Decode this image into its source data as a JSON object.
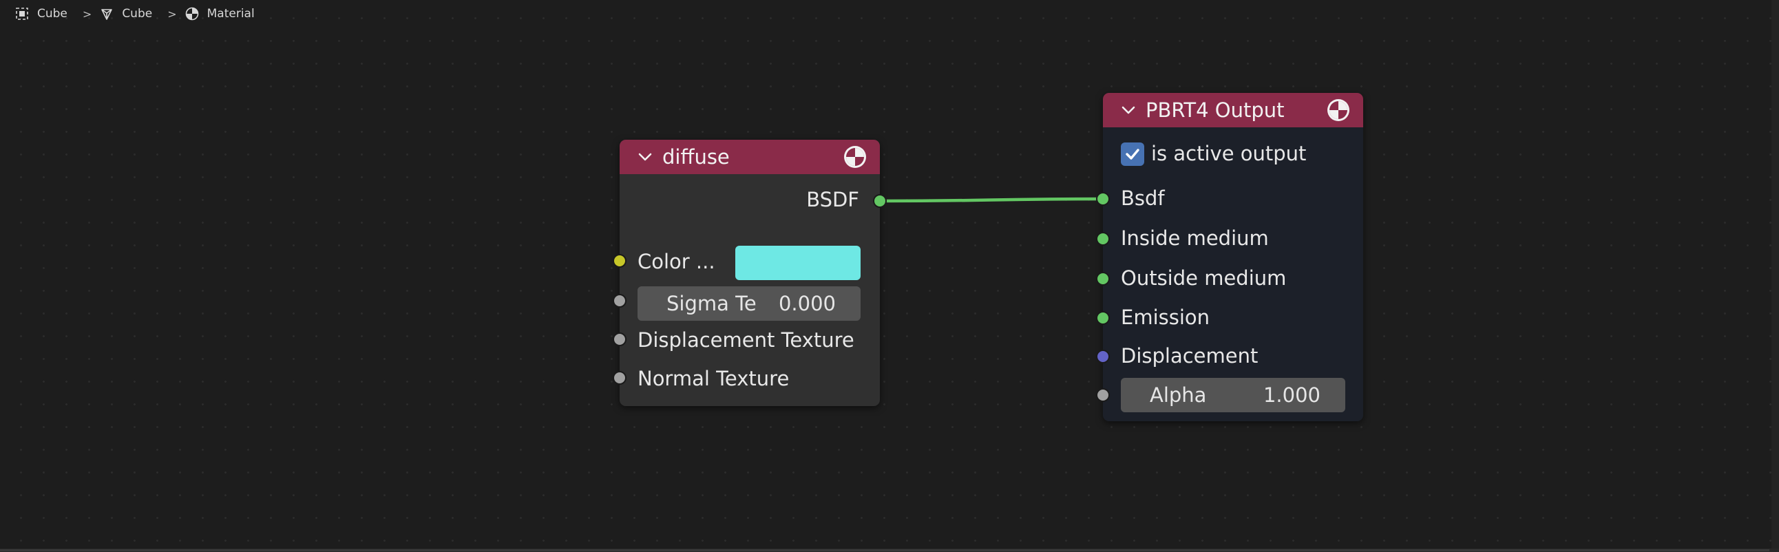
{
  "breadcrumb": {
    "items": [
      {
        "label": "Cube",
        "icon": "object-icon"
      },
      {
        "label": "Cube",
        "icon": "mesh-data-icon"
      },
      {
        "label": "Material",
        "icon": "material-sphere-icon"
      }
    ],
    "separator": ">"
  },
  "nodes": {
    "diffuse": {
      "title": "diffuse",
      "header_color": "#8a2b49",
      "output_socket": "BSDF",
      "color_label": "Color ...",
      "color_value": "#6ee8e4",
      "sigma_label": "Sigma Te",
      "sigma_value": "0.000",
      "displacement_label": "Displacement Texture",
      "normal_label": "Normal Texture"
    },
    "output": {
      "title": "PBRT4 Output",
      "header_color": "#8a2b49",
      "active_label": "is active output",
      "active_checked": true,
      "inputs": [
        "Bsdf",
        "Inside medium",
        "Outside medium",
        "Emission",
        "Displacement"
      ],
      "alpha_label": "Alpha",
      "alpha_value": "1.000"
    }
  },
  "colors": {
    "socket_shader": "#63c763",
    "socket_color": "#c7c729",
    "socket_float": "#a1a1a1",
    "socket_vector": "#6363c7",
    "link": "#63c763",
    "checkbox": "#4772b3"
  }
}
